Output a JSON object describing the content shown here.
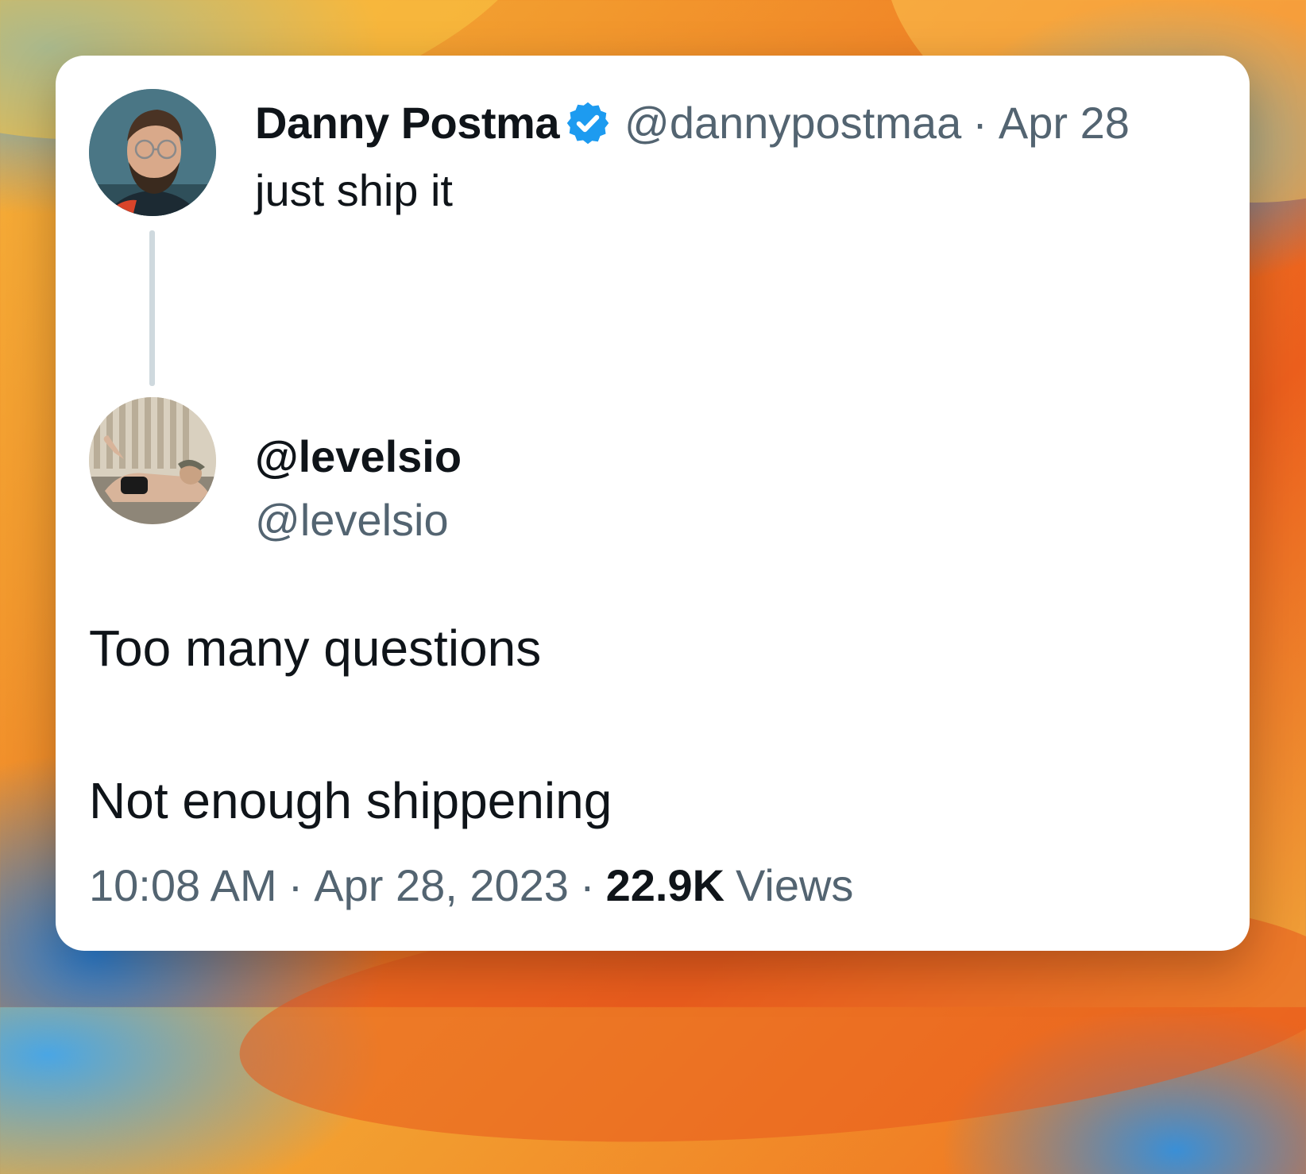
{
  "tweet": {
    "author": {
      "display_name": "Danny Postma",
      "handle": "@dannypostmaa",
      "verified": true,
      "avatar_icon": "profile-photo-icon"
    },
    "separator": "·",
    "date": "Apr 28",
    "text": "just ship it"
  },
  "reply": {
    "display_name": "@levelsio",
    "handle": "@levelsio",
    "avatar_icon": "profile-photo-icon",
    "lines": [
      "Too many questions",
      "Not enough shippening"
    ]
  },
  "meta": {
    "time": "10:08 AM",
    "separator": "·",
    "date": "Apr 28, 2023",
    "views_count": "22.9K",
    "views_label": "Views"
  },
  "colors": {
    "text_primary": "#0f1419",
    "text_secondary": "#536471",
    "verified_blue": "#1d9bf0",
    "thread_line": "#cfd9de"
  }
}
